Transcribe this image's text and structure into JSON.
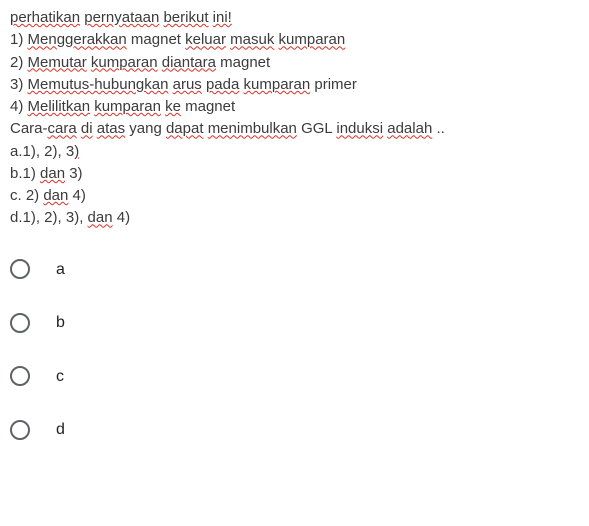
{
  "question": {
    "intro_pre": "perhatikan",
    "intro_mid": "pernyataan",
    "intro_mid2": "berikut",
    "intro_suf": "ini!",
    "lines": [
      {
        "num": "1)",
        "parts": [
          {
            "t": "Menggerakkan",
            "s": true
          },
          {
            "t": " magnet ",
            "s": false
          },
          {
            "t": "keluar",
            "s": true
          },
          {
            "t": " ",
            "s": false
          },
          {
            "t": "masuk",
            "s": true
          },
          {
            "t": " ",
            "s": false
          },
          {
            "t": "kumparan",
            "s": true
          }
        ]
      },
      {
        "num": "2)",
        "parts": [
          {
            "t": "Memutar",
            "s": true
          },
          {
            "t": " ",
            "s": false
          },
          {
            "t": "kumparan",
            "s": true
          },
          {
            "t": " ",
            "s": false
          },
          {
            "t": "diantara",
            "s": true
          },
          {
            "t": " magnet",
            "s": false
          }
        ]
      },
      {
        "num": "3)",
        "parts": [
          {
            "t": "Memutus-hubungkan",
            "s": true
          },
          {
            "t": " ",
            "s": false
          },
          {
            "t": "arus",
            "s": true
          },
          {
            "t": " ",
            "s": false
          },
          {
            "t": "pada",
            "s": true
          },
          {
            "t": " ",
            "s": false
          },
          {
            "t": "kumparan",
            "s": true
          },
          {
            "t": " primer",
            "s": false
          }
        ]
      },
      {
        "num": "4)",
        "parts": [
          {
            "t": "Melilitkan",
            "s": true
          },
          {
            "t": " ",
            "s": false
          },
          {
            "t": "kumparan",
            "s": true
          },
          {
            "t": " ",
            "s": false
          },
          {
            "t": "ke",
            "s": true
          },
          {
            "t": " magnet",
            "s": false
          }
        ]
      }
    ],
    "prompt_parts": [
      {
        "t": "Cara-",
        "s": false
      },
      {
        "t": "cara",
        "s": true
      },
      {
        "t": " ",
        "s": false
      },
      {
        "t": "di",
        "s": true
      },
      {
        "t": " ",
        "s": false
      },
      {
        "t": "atas",
        "s": true
      },
      {
        "t": " yang ",
        "s": false
      },
      {
        "t": "dapat",
        "s": true
      },
      {
        "t": " ",
        "s": false
      },
      {
        "t": "menimbulkan",
        "s": true
      },
      {
        "t": " GGL ",
        "s": false
      },
      {
        "t": "induksi",
        "s": true
      },
      {
        "t": " ",
        "s": false
      },
      {
        "t": "adalah",
        "s": true
      },
      {
        "t": " ..",
        "s": false
      }
    ],
    "answers": [
      {
        "parts": [
          {
            "t": "a.1), 2), 3",
            "s": false
          },
          {
            "t": ")",
            "s": true
          }
        ]
      },
      {
        "parts": [
          {
            "t": "b.1) ",
            "s": false
          },
          {
            "t": "dan",
            "s": true
          },
          {
            "t": " 3)",
            "s": false
          }
        ]
      },
      {
        "parts": [
          {
            "t": "c. 2) ",
            "s": false
          },
          {
            "t": "dan",
            "s": true
          },
          {
            "t": " 4)",
            "s": false
          }
        ]
      },
      {
        "parts": [
          {
            "t": "d.1), 2), 3), ",
            "s": false
          },
          {
            "t": "dan",
            "s": true
          },
          {
            "t": " 4)",
            "s": false
          }
        ]
      }
    ]
  },
  "options": [
    {
      "label": "a"
    },
    {
      "label": "b"
    },
    {
      "label": "c"
    },
    {
      "label": "d"
    }
  ]
}
